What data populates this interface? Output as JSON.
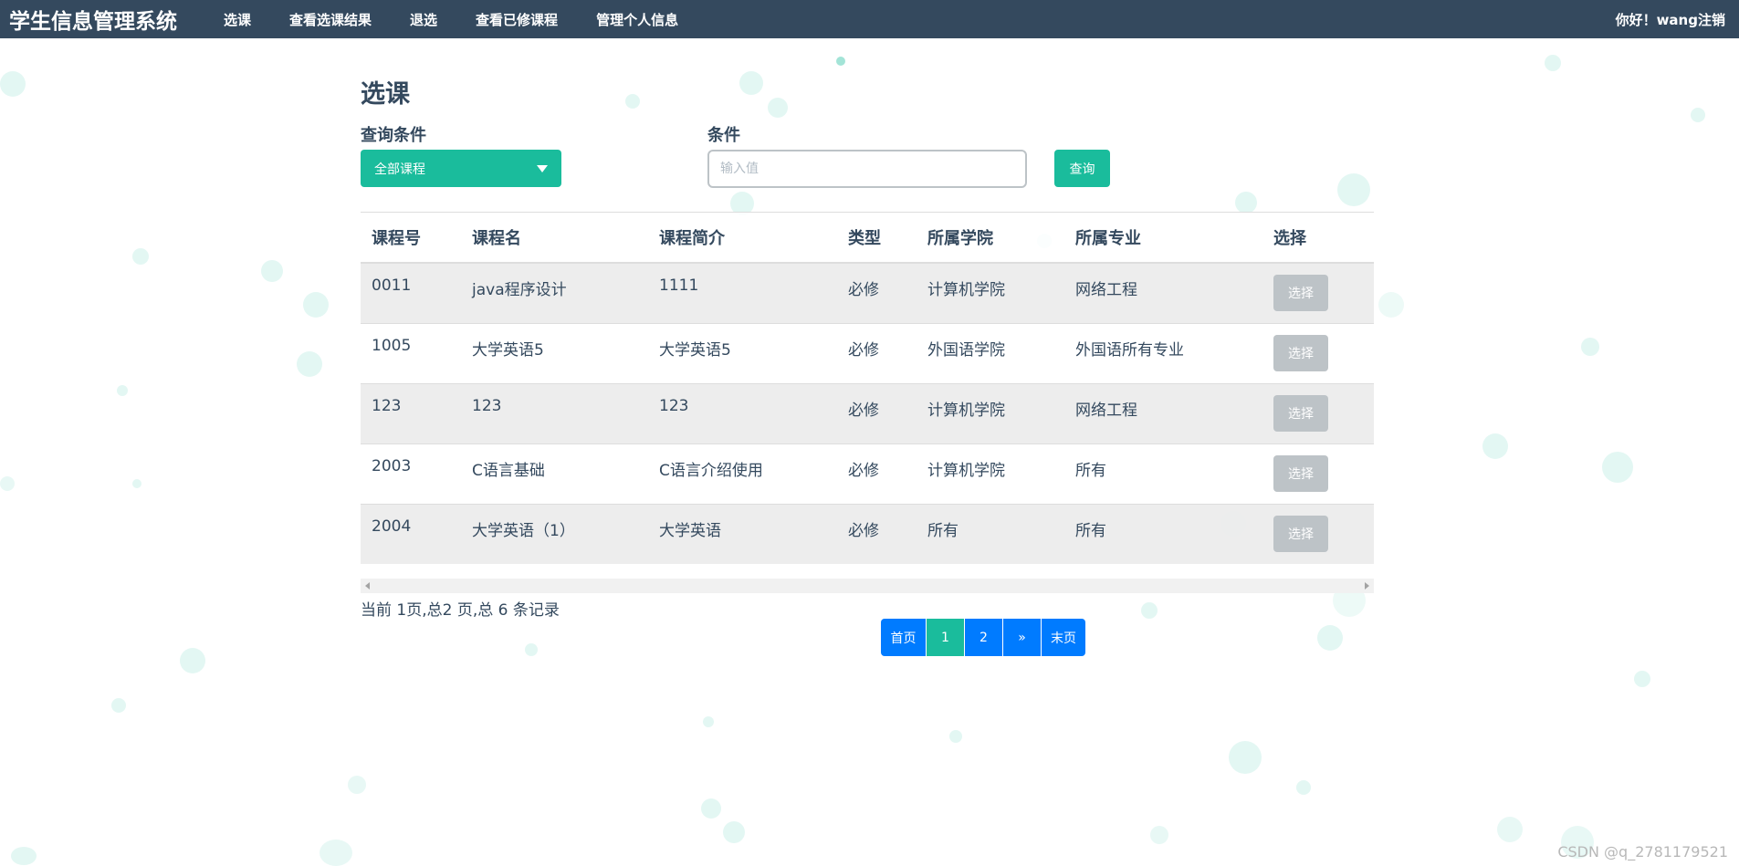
{
  "navbar": {
    "brand": "学生信息管理系统",
    "items": [
      {
        "label": "选课"
      },
      {
        "label": "查看选课结果"
      },
      {
        "label": "退选"
      },
      {
        "label": "查看已修课程"
      },
      {
        "label": "管理个人信息"
      }
    ],
    "greeting": "你好！wang",
    "logout": "注销"
  },
  "page": {
    "title": "选课"
  },
  "query": {
    "condition_label": "查询条件",
    "condition_value": "全部课程",
    "input_label": "条件",
    "input_placeholder": "输入值",
    "button": "查询"
  },
  "table": {
    "headers": [
      "课程号",
      "课程名",
      "课程简介",
      "类型",
      "所属学院",
      "所属专业",
      "选择"
    ],
    "rows": [
      {
        "id": "0011",
        "name": "java程序设计",
        "intro": "1111",
        "type": "必修",
        "college": "计算机学院",
        "major": "网络工程",
        "action": "选择"
      },
      {
        "id": "1005",
        "name": "大学英语5",
        "intro": "大学英语5",
        "type": "必修",
        "college": "外国语学院",
        "major": "外国语所有专业",
        "action": "选择"
      },
      {
        "id": "123",
        "name": "123",
        "intro": "123",
        "type": "必修",
        "college": "计算机学院",
        "major": "网络工程",
        "action": "选择"
      },
      {
        "id": "2003",
        "name": "C语言基础",
        "intro": "C语言介绍使用",
        "type": "必修",
        "college": "计算机学院",
        "major": "所有",
        "action": "选择"
      },
      {
        "id": "2004",
        "name": "大学英语（1）",
        "intro": "大学英语",
        "type": "必修",
        "college": "所有",
        "major": "所有",
        "action": "选择"
      }
    ]
  },
  "pagination": {
    "info": "当前 1页,总2 页,总 6 条记录",
    "first": "首页",
    "pages": [
      "1",
      "2"
    ],
    "next": "»",
    "last": "末页"
  },
  "watermark": "CSDN @q_2781179521",
  "colors": {
    "navbar": "#34495e",
    "accent": "#1abc9c",
    "pager_blue": "#007bff",
    "disabled_button": "#bdc3c7"
  }
}
